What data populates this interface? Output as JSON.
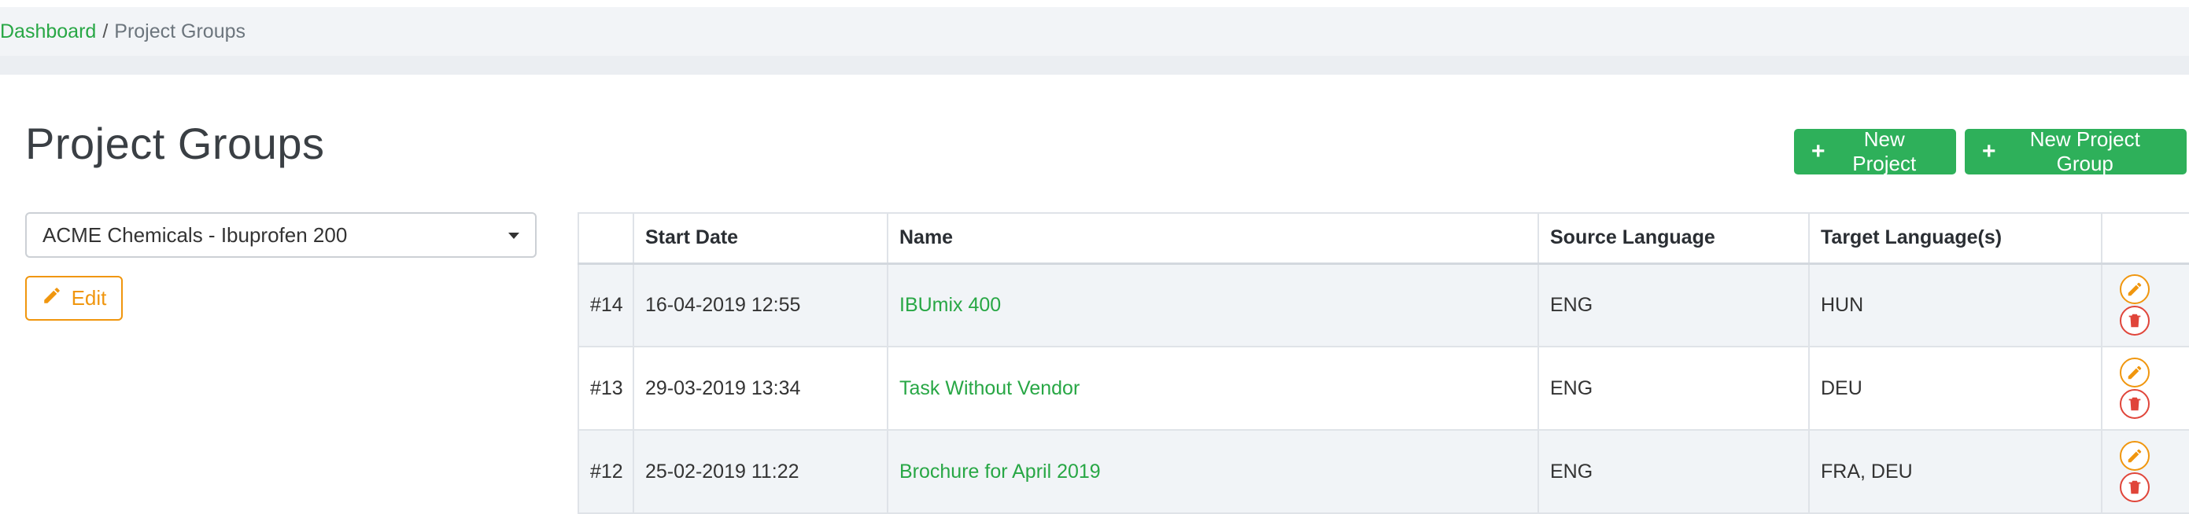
{
  "breadcrumb": {
    "home": "Dashboard",
    "separator": "/",
    "current": "Project Groups"
  },
  "page": {
    "title": "Project Groups"
  },
  "actions": {
    "new_project": "New Project",
    "new_project_group": "New Project Group",
    "edit": "Edit"
  },
  "group_select": {
    "value": "ACME Chemicals - Ibuprofen 200"
  },
  "table": {
    "headers": [
      "",
      "Start Date",
      "Name",
      "Source Language",
      "Target Language(s)",
      ""
    ],
    "rows": [
      {
        "id": "#14",
        "start": "16-04-2019 12:55",
        "name": "IBUmix 400",
        "source": "ENG",
        "target": "HUN"
      },
      {
        "id": "#13",
        "start": "29-03-2019 13:34",
        "name": "Task Without Vendor",
        "source": "ENG",
        "target": "DEU"
      },
      {
        "id": "#12",
        "start": "25-02-2019 11:22",
        "name": "Brochure for April 2019",
        "source": "ENG",
        "target": "FRA, DEU"
      }
    ]
  },
  "icons": {
    "plus": "plus-icon",
    "pencil": "pencil-icon",
    "trash": "trash-icon",
    "caret": "caret-down-icon"
  },
  "colors": {
    "accent_green": "#2eb05a",
    "link_green": "#28a745",
    "edit_orange": "#f0960e",
    "delete_red": "#e0453a"
  }
}
